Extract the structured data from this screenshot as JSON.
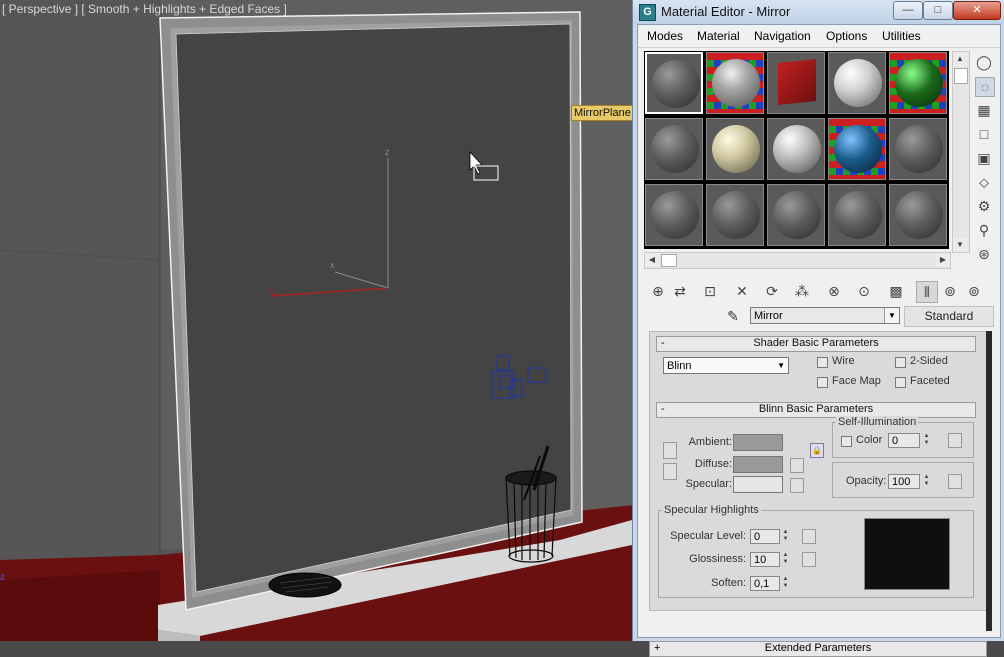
{
  "viewport": {
    "label": "[ Perspective ] [ Smooth + Highlights + Edged Faces ]",
    "object_tag": "MirrorPlane",
    "gizmo_x": "x",
    "gizmo_y": "y",
    "gizmo_z": "z",
    "corner_axis": "z"
  },
  "window": {
    "title": "Material Editor - Mirror",
    "app_icon_glyph": "G",
    "minimize_glyph": "—",
    "maximize_glyph": "□",
    "close_glyph": "✕"
  },
  "menu": [
    "Modes",
    "Material",
    "Navigation",
    "Options",
    "Utilities"
  ],
  "slots": [
    {
      "style": "gray",
      "selected": true
    },
    {
      "style": "checker-gray"
    },
    {
      "style": "red-box"
    },
    {
      "style": "white"
    },
    {
      "style": "checker-green"
    },
    {
      "style": "gray"
    },
    {
      "style": "cream"
    },
    {
      "style": "white-noise"
    },
    {
      "style": "blue-checker"
    },
    {
      "style": "gray"
    },
    {
      "style": "gray"
    },
    {
      "style": "gray"
    },
    {
      "style": "gray"
    },
    {
      "style": "gray"
    },
    {
      "style": "gray"
    }
  ],
  "material": {
    "name": "Mirror",
    "type_button": "Standard"
  },
  "shader_basic": {
    "title": "Shader Basic Parameters",
    "collapse_sign": "-",
    "shader": "Blinn",
    "wire": "Wire",
    "two_sided": "2-Sided",
    "face_map": "Face Map",
    "faceted": "Faceted"
  },
  "blinn_basic": {
    "title": "Blinn Basic Parameters",
    "collapse_sign": "-",
    "ambient_label": "Ambient:",
    "diffuse_label": "Diffuse:",
    "specular_label": "Specular:",
    "ambient_color": "#9a9a9a",
    "diffuse_color": "#9a9a9a",
    "specular_color": "#e6e6e6",
    "self_illum_title": "Self-Illumination",
    "color_label": "Color",
    "color_value": "0",
    "opacity_label": "Opacity:",
    "opacity_value": "100"
  },
  "specular_highlights": {
    "title": "Specular Highlights",
    "level_label": "Specular Level:",
    "level_value": "0",
    "gloss_label": "Glossiness:",
    "gloss_value": "10",
    "soften_label": "Soften:",
    "soften_value": "0,1"
  },
  "extended": {
    "title": "Extended Parameters",
    "expand_sign": "+"
  }
}
